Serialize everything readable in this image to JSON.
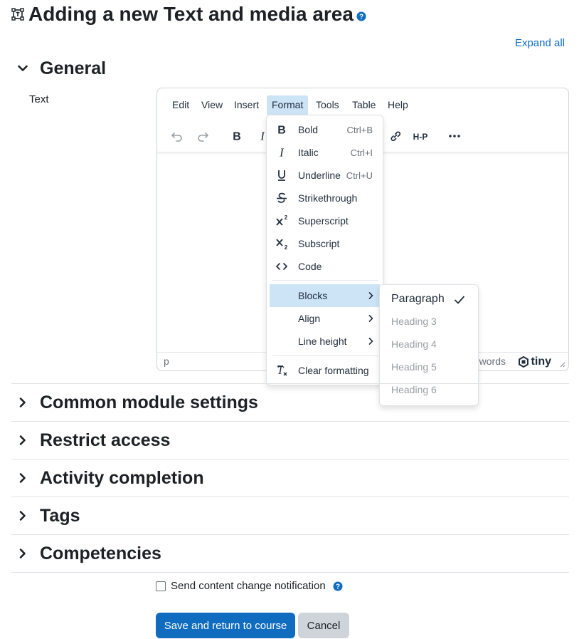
{
  "page": {
    "title": "Adding a new Text and media area",
    "expand_all": "Expand all"
  },
  "sections": {
    "general": "General",
    "common": "Common module settings",
    "restrict": "Restrict access",
    "completion": "Activity completion",
    "tags": "Tags",
    "competencies": "Competencies"
  },
  "field": {
    "text_label": "Text"
  },
  "editor": {
    "menus": [
      "Edit",
      "View",
      "Insert",
      "Format",
      "Tools",
      "Table",
      "Help"
    ],
    "active_menu": "Format",
    "status_path": "p",
    "words_fragment": "words",
    "brand": "tiny"
  },
  "format_menu": {
    "items": [
      {
        "label": "Bold",
        "shortcut": "Ctrl+B",
        "icon": "bold-icon"
      },
      {
        "label": "Italic",
        "shortcut": "Ctrl+I",
        "icon": "italic-icon"
      },
      {
        "label": "Underline",
        "shortcut": "Ctrl+U",
        "icon": "underline-icon"
      },
      {
        "label": "Strikethrough",
        "shortcut": "",
        "icon": "strikethrough-icon"
      },
      {
        "label": "Superscript",
        "shortcut": "",
        "icon": "superscript-icon"
      },
      {
        "label": "Subscript",
        "shortcut": "",
        "icon": "subscript-icon"
      },
      {
        "label": "Code",
        "shortcut": "",
        "icon": "code-icon"
      }
    ],
    "submenus": [
      {
        "label": "Blocks",
        "active": true
      },
      {
        "label": "Align",
        "active": false
      },
      {
        "label": "Line height",
        "active": false
      }
    ],
    "clear_formatting": "Clear formatting"
  },
  "blocks_menu": {
    "items": [
      "Paragraph",
      "Heading 3",
      "Heading 4",
      "Heading 5",
      "Heading 6"
    ],
    "selected": "Paragraph"
  },
  "footer": {
    "notify_label": "Send content change notification",
    "save_label": "Save and return to course",
    "cancel_label": "Cancel"
  },
  "colors": {
    "primary": "#0f6cbf",
    "active_menu_bg": "#cde4f7",
    "help_icon": "#0f6cbf"
  }
}
